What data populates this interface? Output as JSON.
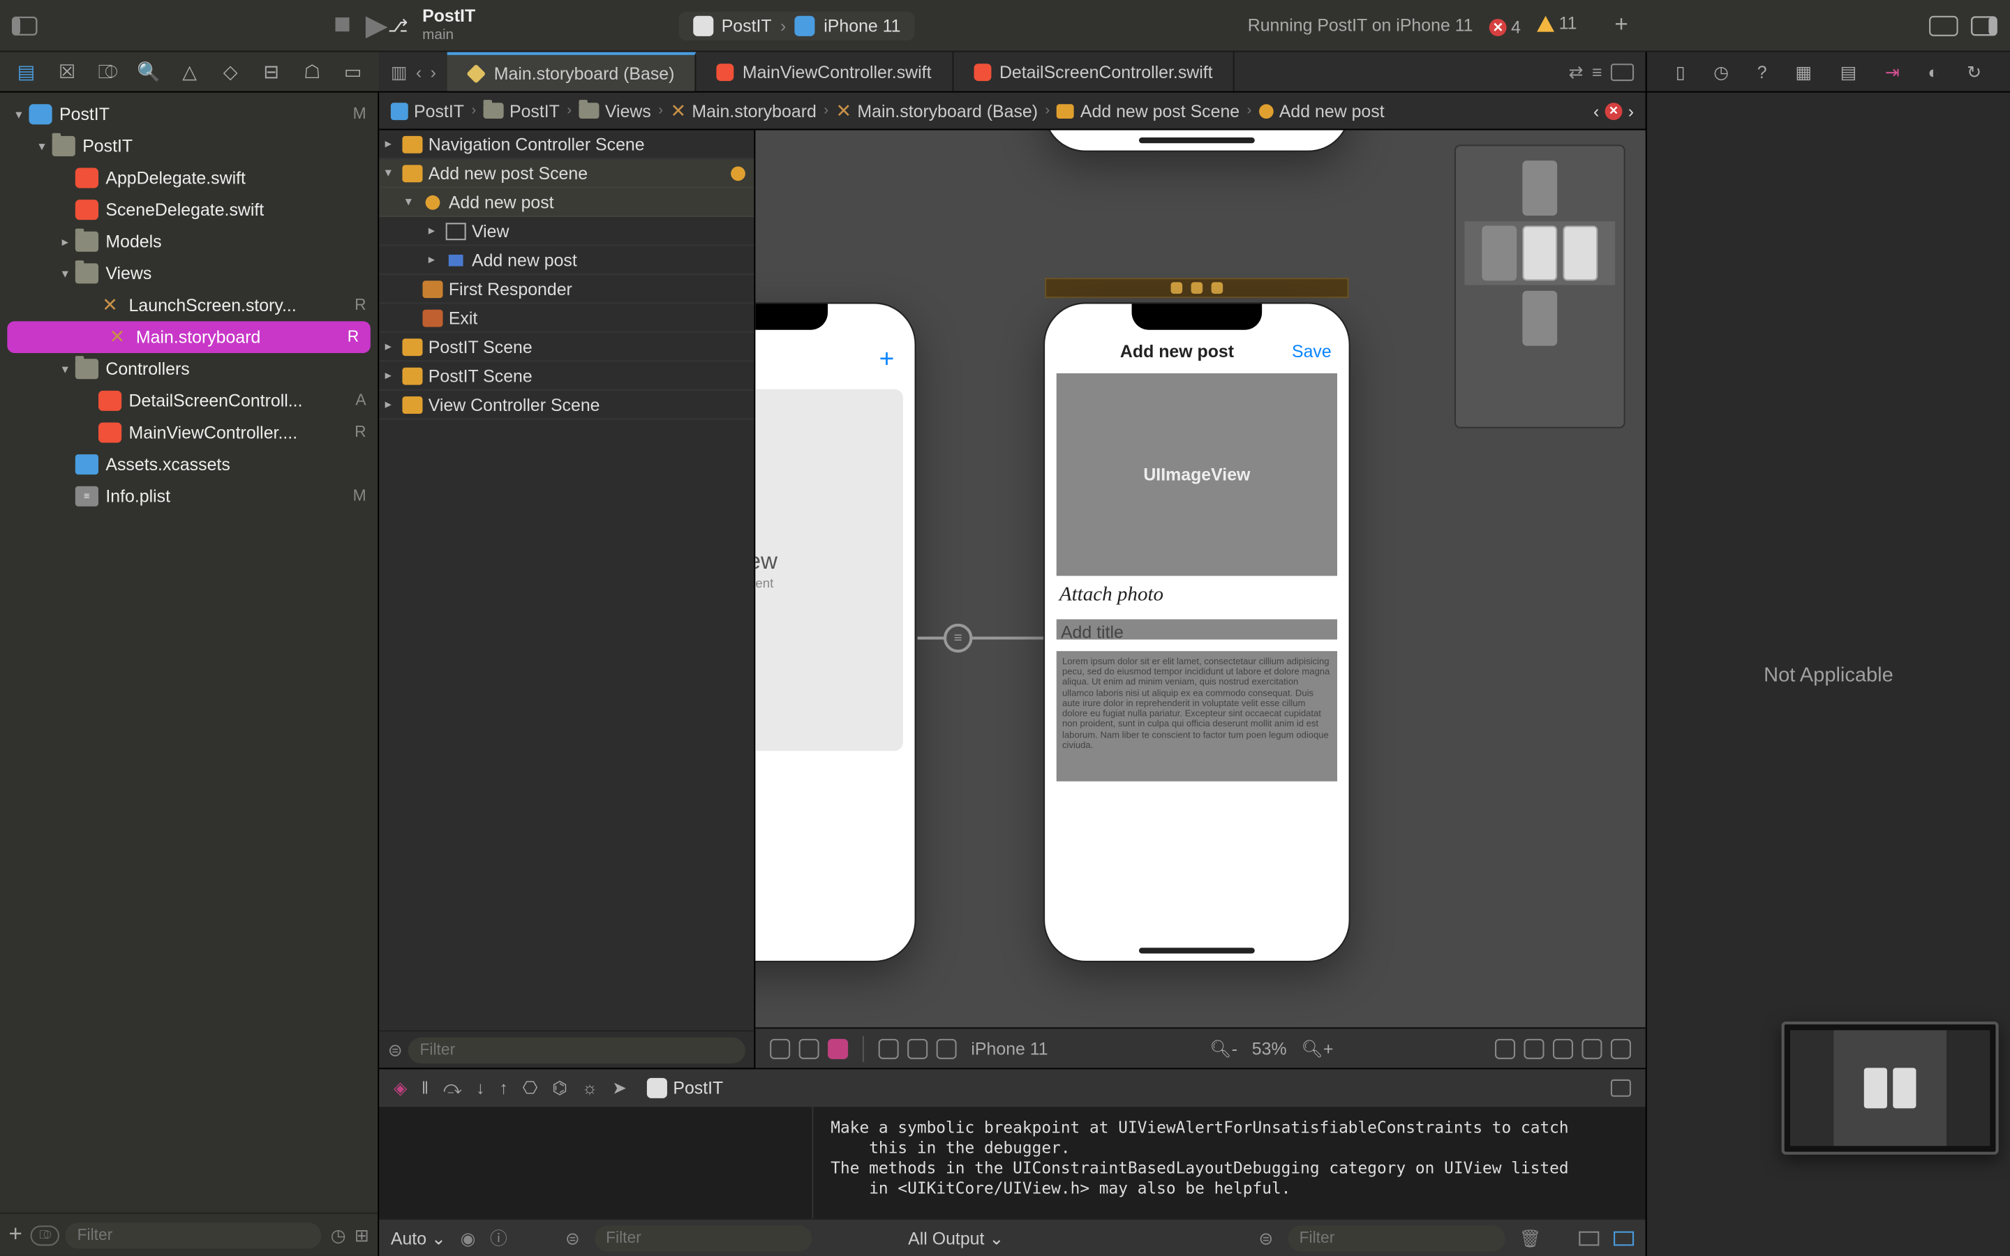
{
  "titlebar": {
    "project": "PostIT",
    "branch": "main",
    "scheme": "PostIT",
    "destination": "iPhone 11",
    "status": "Running PostIT on iPhone 11",
    "errors": "4",
    "warnings": "11"
  },
  "tabs": [
    {
      "label": "Main.storyboard (Base)",
      "type": "storyboard",
      "active": true
    },
    {
      "label": "MainViewController.swift",
      "type": "swift",
      "active": false
    },
    {
      "label": "DetailScreenController.swift",
      "type": "swift",
      "active": false
    }
  ],
  "navigator": {
    "filter_placeholder": "Filter",
    "items": [
      {
        "indent": 0,
        "label": "PostIT",
        "icon": "app",
        "disc": "v",
        "stat": "M"
      },
      {
        "indent": 1,
        "label": "PostIT",
        "icon": "folder",
        "disc": "v"
      },
      {
        "indent": 2,
        "label": "AppDelegate.swift",
        "icon": "swift"
      },
      {
        "indent": 2,
        "label": "SceneDelegate.swift",
        "icon": "swift"
      },
      {
        "indent": 2,
        "label": "Models",
        "icon": "folder",
        "disc": ">"
      },
      {
        "indent": 2,
        "label": "Views",
        "icon": "folder",
        "disc": "v"
      },
      {
        "indent": 3,
        "label": "LaunchScreen.story...",
        "icon": "storyboard",
        "stat": "R"
      },
      {
        "indent": 3,
        "label": "Main.storyboard",
        "icon": "storyboard",
        "stat": "R",
        "selected": true
      },
      {
        "indent": 2,
        "label": "Controllers",
        "icon": "folder",
        "disc": "v"
      },
      {
        "indent": 3,
        "label": "DetailScreenControll...",
        "icon": "swift",
        "stat": "A"
      },
      {
        "indent": 3,
        "label": "MainViewController....",
        "icon": "swift",
        "stat": "R"
      },
      {
        "indent": 2,
        "label": "Assets.xcassets",
        "icon": "assets"
      },
      {
        "indent": 2,
        "label": "Info.plist",
        "icon": "plist",
        "stat": "M"
      }
    ]
  },
  "breadcrumb": [
    "PostIT",
    "PostIT",
    "Views",
    "Main.storyboard",
    "Main.storyboard (Base)",
    "Add new post Scene",
    "Add new post"
  ],
  "outline": {
    "filter_placeholder": "Filter",
    "items": [
      {
        "indent": 0,
        "label": "Navigation Controller Scene",
        "disc": ">",
        "icon": "scene"
      },
      {
        "indent": 0,
        "label": "Add new post Scene",
        "disc": "v",
        "icon": "scene",
        "sel": true,
        "badge": true
      },
      {
        "indent": 1,
        "label": "Add new post",
        "disc": "v",
        "icon": "vc",
        "sel": true
      },
      {
        "indent": 2,
        "label": "View",
        "disc": ">",
        "icon": "view"
      },
      {
        "indent": 2,
        "label": "Add new post",
        "disc": ">",
        "icon": "navitem"
      },
      {
        "indent": 1,
        "label": "First Responder",
        "icon": "responder"
      },
      {
        "indent": 1,
        "label": "Exit",
        "icon": "exit"
      },
      {
        "indent": 0,
        "label": "PostIT Scene",
        "disc": ">",
        "icon": "scene"
      },
      {
        "indent": 0,
        "label": "PostIT Scene",
        "disc": ">",
        "icon": "scene"
      },
      {
        "indent": 0,
        "label": "View Controller Scene",
        "disc": ">",
        "icon": "scene"
      }
    ]
  },
  "canvas": {
    "device_label": "iPhone 11",
    "zoom": "53%",
    "screen": {
      "nav_title": "Add new post",
      "save_label": "Save",
      "image_placeholder": "UIImageView",
      "attach_label": "Attach photo",
      "title_placeholder": "Add title",
      "body_text": "Lorem ipsum dolor sit er elit lamet, consectetaur cillium adipisicing pecu, sed do eiusmod tempor incididunt ut labore et dolore magna aliqua. Ut enim ad minim veniam, quis nostrud exercitation ullamco laboris nisi ut aliquip ex ea commodo consequat. Duis aute irure dolor in reprehenderit in voluptate velit esse cillum dolore eu fugiat nulla pariatur. Excepteur sint occaecat cupidatat non proident, sunt in culpa qui officia deserunt mollit anim id est laborum. Nam liber te conscient to factor tum poen legum odioque civiuda."
    },
    "left_card": {
      "title": "ew",
      "subtitle": "tent"
    }
  },
  "debug": {
    "process": "PostIT",
    "auto_label": "Auto",
    "filter_placeholder": "Filter",
    "output_label": "All Output",
    "console_text": "Make a symbolic breakpoint at UIViewAlertForUnsatisfiableConstraints to catch\n    this in the debugger.\nThe methods in the UIConstraintBasedLayoutDebugging category on UIView listed\n    in <UIKitCore/UIView.h> may also be helpful."
  },
  "inspector": {
    "na_label": "Not Applicable"
  }
}
